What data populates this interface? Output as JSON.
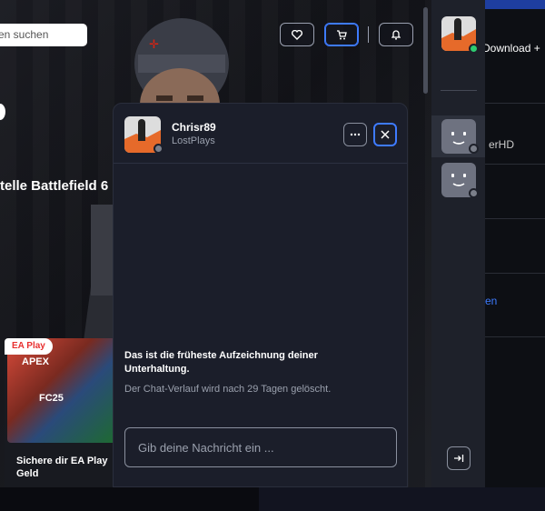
{
  "store": {
    "search_placeholder": "Spiele oder Inhalte suchen",
    "search_visible_text": "en suchen",
    "hero_title": "telle Battlefield 6",
    "promo": {
      "badge": "EA Play",
      "apex_label": "APEX",
      "fc_label": "FC25",
      "text": "Sichere dir EA Play Geld"
    }
  },
  "right_edge": {
    "download_text": "Download +",
    "user_text": "erHD",
    "link_text": "en"
  },
  "chat": {
    "friend_name": "Chrisr89",
    "friend_subtitle": "LostPlays",
    "notice_title": "Das ist die früheste Aufzeichnung deiner Unterhaltung.",
    "notice_sub": "Der Chat-Verlauf wird nach 29 Tagen gelöscht.",
    "input_placeholder": "Gib deine Nachricht ein ..."
  },
  "colors": {
    "accent": "#3e7bff",
    "online": "#2ecc71",
    "offline": "#7b7f8a"
  },
  "icons": {
    "wishlist": "heart-icon",
    "cart": "cart-icon",
    "notifications": "bell-icon",
    "more": "ellipsis-icon",
    "close": "close-icon",
    "collapse": "arrow-right-bar-icon",
    "target": "crosshair-icon"
  }
}
